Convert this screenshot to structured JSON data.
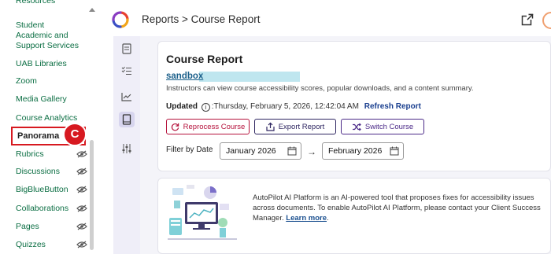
{
  "nav": {
    "items": [
      {
        "label": "Resources",
        "hidden": false
      },
      {
        "label": "Student Academic and Support Services",
        "hidden": false
      },
      {
        "label": "UAB Libraries",
        "hidden": false
      },
      {
        "label": "Zoom",
        "hidden": false
      },
      {
        "label": "Media Gallery",
        "hidden": false
      },
      {
        "label": "Course Analytics",
        "hidden": false
      },
      {
        "label": "Panorama",
        "hidden": false
      },
      {
        "label": "Rubrics",
        "hidden": true
      },
      {
        "label": "Discussions",
        "hidden": true
      },
      {
        "label": "BigBlueButton",
        "hidden": true
      },
      {
        "label": "Collaborations",
        "hidden": true
      },
      {
        "label": "Pages",
        "hidden": true
      },
      {
        "label": "Quizzes",
        "hidden": true
      }
    ],
    "callout_letter": "C"
  },
  "header": {
    "breadcrumb": "Reports > Course Report"
  },
  "report": {
    "title": "Course Report",
    "course_link": "sandbox",
    "description": "Instructors can view course accessibility scores, popular downloads, and a content summary.",
    "updated_label": "Updated",
    "updated_value": ":Thursday, February 5, 2026, 12:42:04 AM",
    "refresh_label": "Refresh Report",
    "buttons": {
      "reprocess": "Reprocess Course",
      "export": "Export Report",
      "switch": "Switch Course"
    },
    "filter_label": "Filter by Date",
    "date_from": "January 2026",
    "date_to": "February 2026"
  },
  "autopilot": {
    "text": "AutoPilot AI Platform is an AI-powered tool that proposes fixes for accessibility issues across documents. To enable AutoPilot AI Platform, please contact your Client Success Manager.",
    "link": "Learn more"
  },
  "colors": {
    "nav_link": "#0b6e43",
    "highlight_red": "#d71920",
    "reprocess": "#b5123c",
    "export": "#2d2560",
    "switch": "#4b2a88"
  }
}
